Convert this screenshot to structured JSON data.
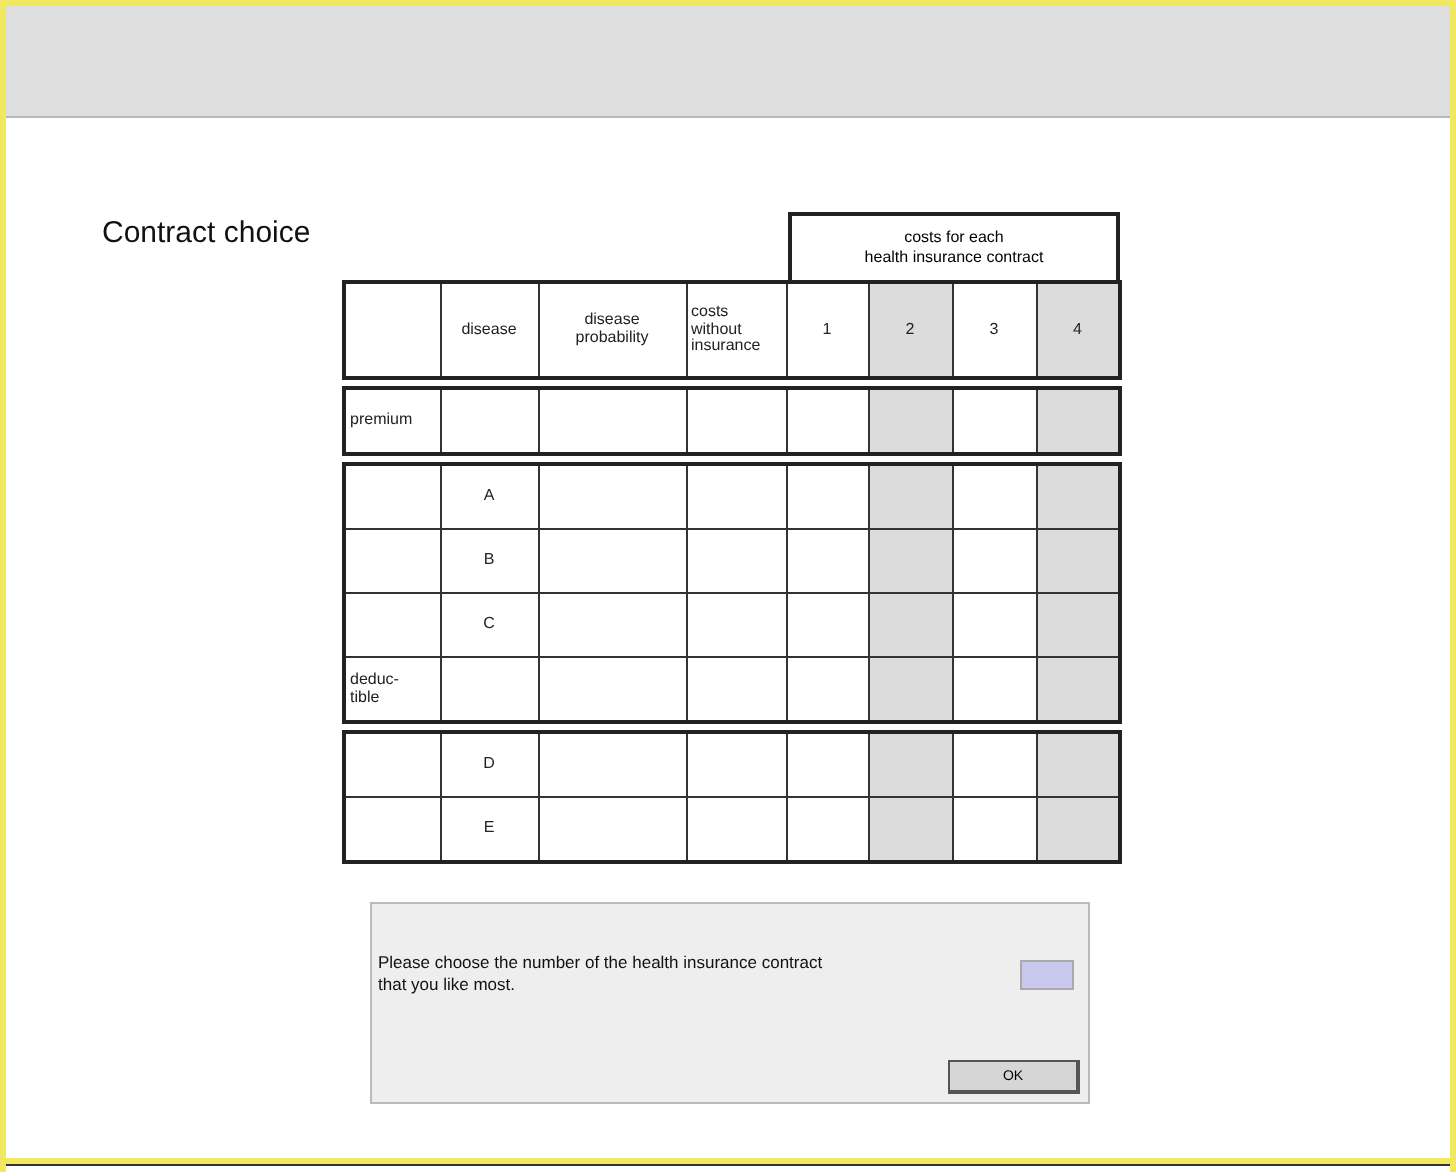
{
  "title": "Contract choice",
  "table": {
    "group_header": "costs for each\nhealth insurance contract",
    "columns": [
      {
        "label": "disease"
      },
      {
        "label": "disease\nprobability"
      },
      {
        "label": "costs\nwithout\ninsurance"
      }
    ],
    "contracts": [
      {
        "label": "1",
        "shaded": false
      },
      {
        "label": "2",
        "shaded": true
      },
      {
        "label": "3",
        "shaded": false
      },
      {
        "label": "4",
        "shaded": true
      }
    ],
    "blocks": [
      {
        "rows": [
          {
            "row_label": "premium"
          }
        ]
      },
      {
        "rows": [
          {
            "disease": "A"
          },
          {
            "disease": "B"
          },
          {
            "disease": "C"
          },
          {
            "row_label": "deduc-\ntible"
          }
        ]
      },
      {
        "rows": [
          {
            "disease": "D"
          },
          {
            "disease": "E"
          }
        ]
      }
    ]
  },
  "dialog": {
    "prompt": "Please choose the number of the health insurance contract\nthat you like most.",
    "button": "OK"
  }
}
